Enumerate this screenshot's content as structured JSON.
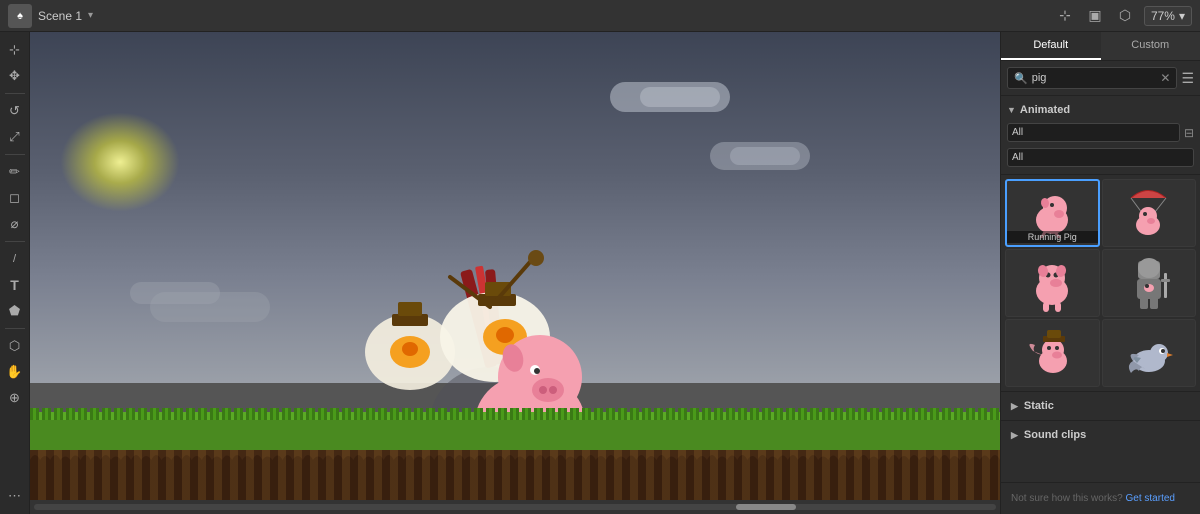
{
  "topbar": {
    "scene_label": "Scene 1",
    "zoom_value": "77%",
    "dropdown_symbol": "▾"
  },
  "tools": [
    {
      "name": "select-tool",
      "icon": "⊹",
      "active": false
    },
    {
      "name": "move-tool",
      "icon": "✥",
      "active": false
    },
    {
      "name": "rotate-tool",
      "icon": "↺",
      "active": false
    },
    {
      "name": "scale-tool",
      "icon": "⤢",
      "active": false
    },
    {
      "name": "paint-tool",
      "icon": "✏",
      "active": false
    },
    {
      "name": "eraser-tool",
      "icon": "◻",
      "active": false
    },
    {
      "name": "eyedropper-tool",
      "icon": "⌀",
      "active": false
    },
    {
      "name": "pen-tool",
      "icon": "/",
      "active": false
    },
    {
      "name": "text-tool",
      "icon": "T",
      "active": false
    },
    {
      "name": "fill-tool",
      "icon": "⬟",
      "active": false
    },
    {
      "name": "brush-tool",
      "icon": "⌘",
      "active": false
    },
    {
      "name": "camera-tool",
      "icon": "⬡",
      "active": false
    },
    {
      "name": "hand-tool",
      "icon": "✋",
      "active": false
    },
    {
      "name": "zoom-tool",
      "icon": "⊕",
      "active": false
    },
    {
      "name": "more-tool",
      "icon": "⋯",
      "active": false
    }
  ],
  "right_panel": {
    "tab_default": "Default",
    "tab_custom": "Custom",
    "search_placeholder": "pig",
    "search_value": "pig",
    "filter1_options": [
      "All"
    ],
    "filter1_selected": "All",
    "filter2_options": [
      "All"
    ],
    "filter2_selected": "All",
    "category_animated": "Animated",
    "category_static": "Static",
    "category_sound_clips": "Sound clips",
    "assets": [
      {
        "id": 1,
        "label": "Running Pig",
        "selected": true
      },
      {
        "id": 2,
        "label": "",
        "selected": false
      },
      {
        "id": 3,
        "label": "",
        "selected": false
      },
      {
        "id": 4,
        "label": "",
        "selected": false
      },
      {
        "id": 5,
        "label": "",
        "selected": false
      },
      {
        "id": 6,
        "label": "",
        "selected": false
      }
    ],
    "help_text": "Not sure how this works?",
    "help_link": "Get started"
  }
}
